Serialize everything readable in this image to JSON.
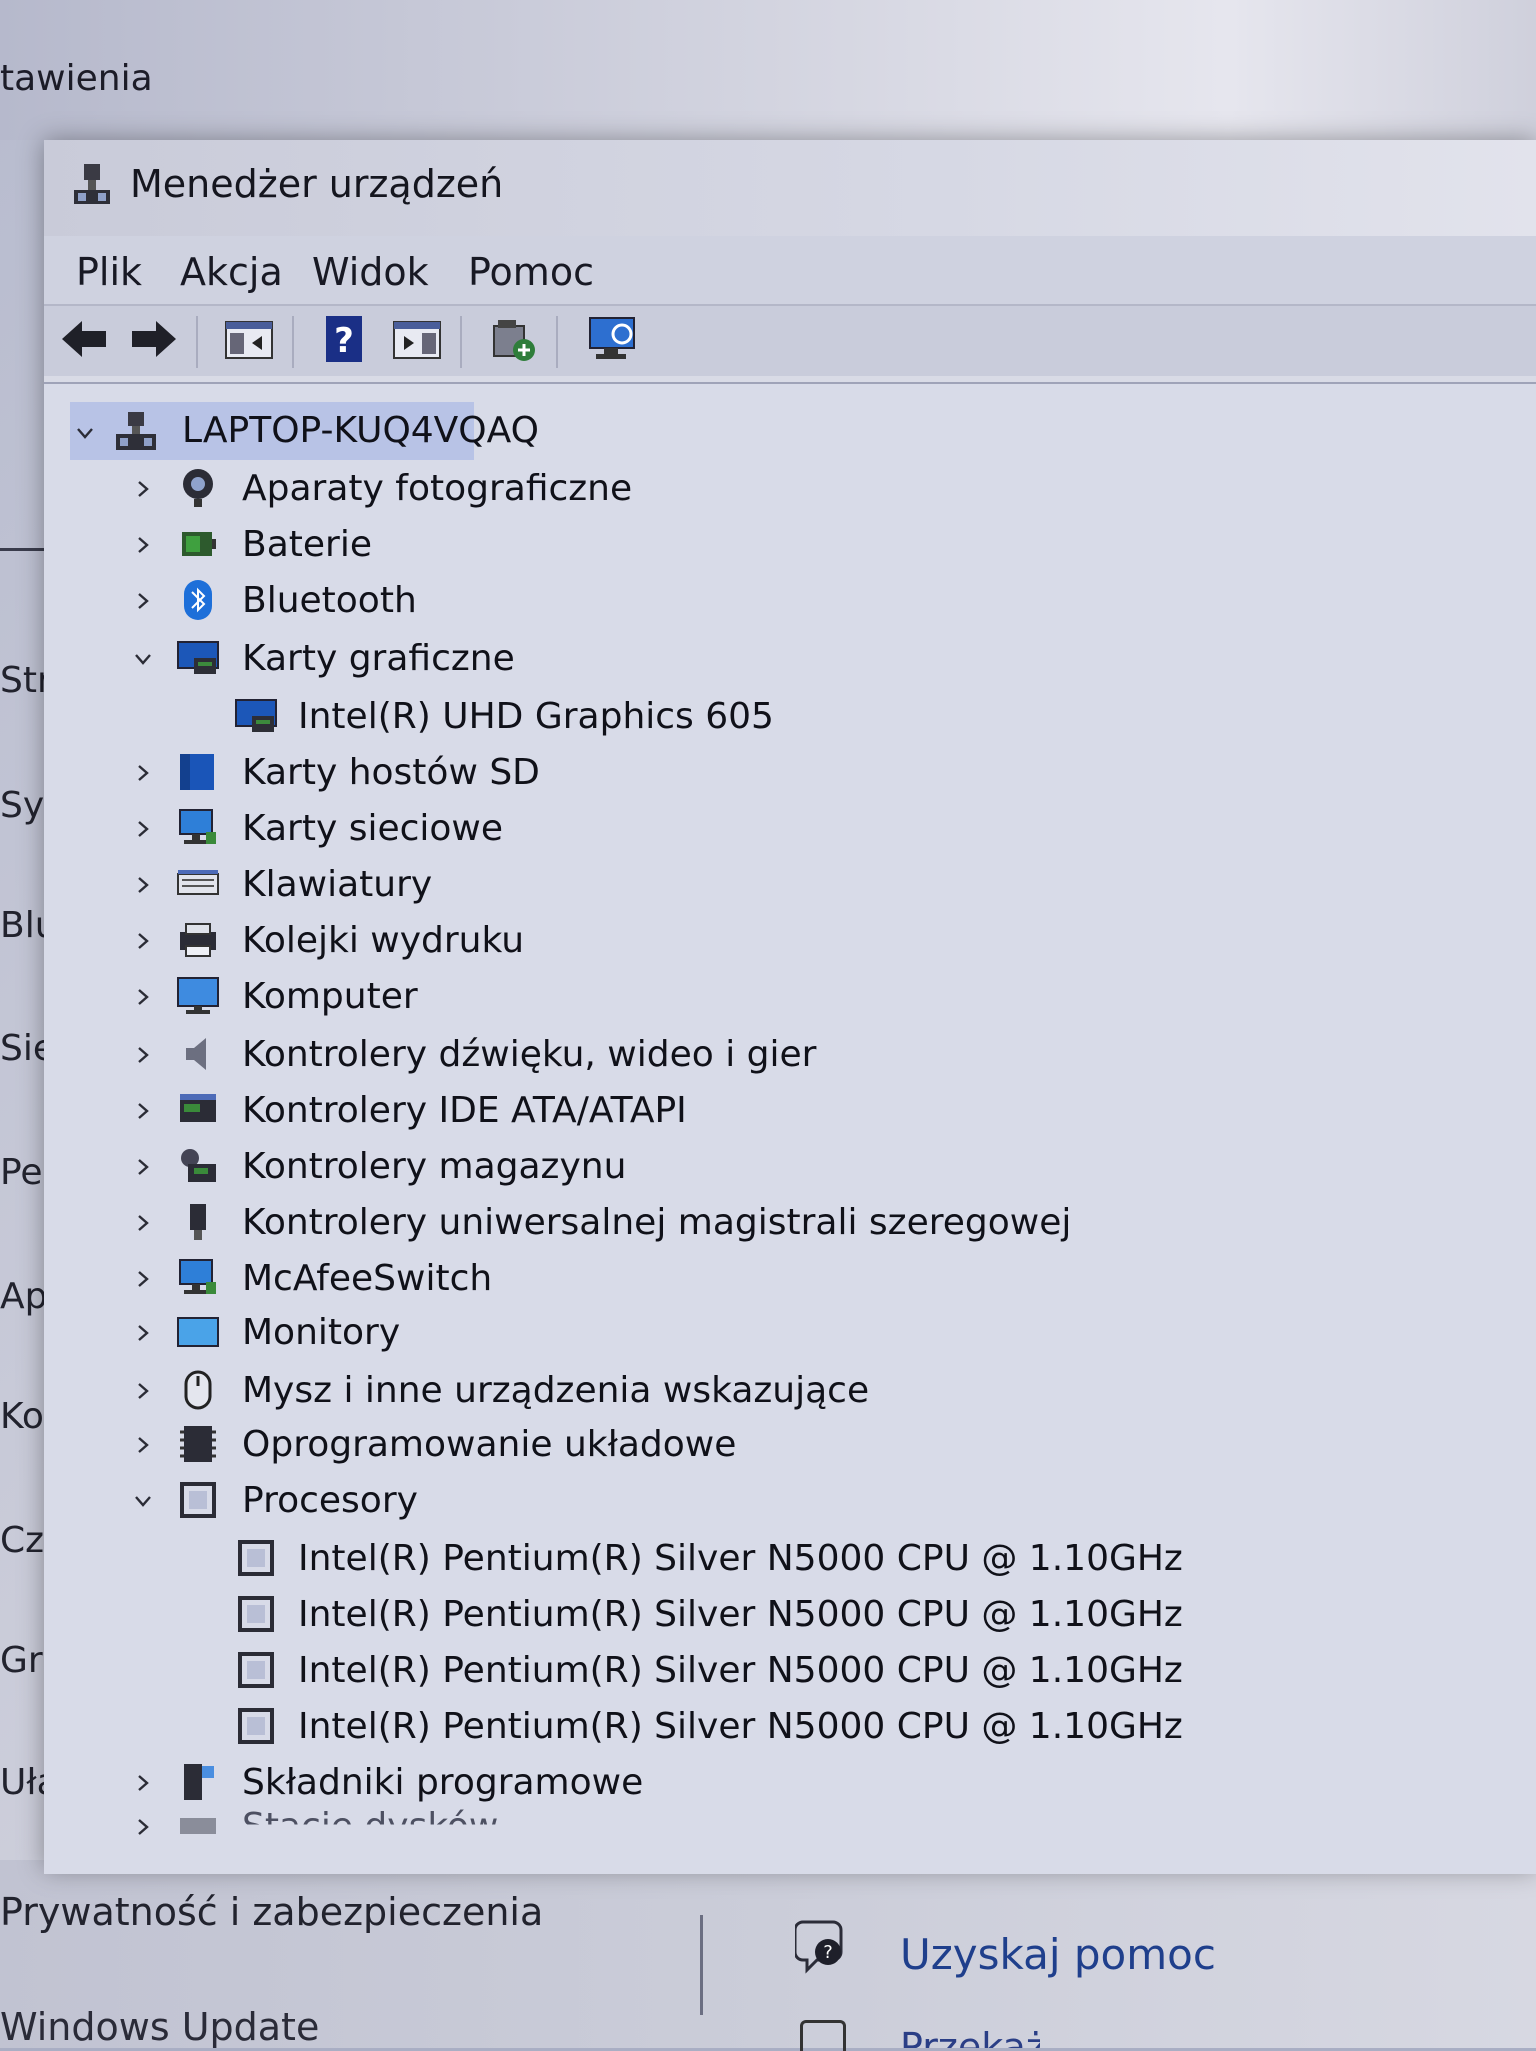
{
  "background": {
    "title": "tawienia",
    "nav_fragments": [
      "Stri",
      "Sys",
      "Blu",
      "Sie",
      "Per",
      "Ap",
      "Koi",
      "Cza",
      "Gra",
      "Uła"
    ],
    "privacy_label": "Prywatność i zabezpieczenia",
    "update_label": "Windows Update",
    "help_label": "Uzyskaj pomoc",
    "feedback_label": "Przekaż opinię"
  },
  "window": {
    "title": "Menedżer urządzeń",
    "menu": [
      "Plik",
      "Akcja",
      "Widok",
      "Pomoc"
    ],
    "toolbar_icons": [
      "back-arrow-icon",
      "forward-arrow-icon",
      "properties-panel-icon",
      "help-icon",
      "action-pane-icon",
      "update-driver-icon",
      "monitor-scan-icon"
    ]
  },
  "tree": {
    "root": "LAPTOP-KUQ4VQAQ",
    "items": [
      {
        "label": "Aparaty fotograficzne",
        "icon": "camera-icon",
        "expanded": false
      },
      {
        "label": "Baterie",
        "icon": "battery-icon",
        "expanded": false
      },
      {
        "label": "Bluetooth",
        "icon": "bluetooth-icon",
        "expanded": false
      },
      {
        "label": "Karty graficzne",
        "icon": "display-adapter-icon",
        "expanded": true
      },
      {
        "label": "Intel(R) UHD Graphics 605",
        "icon": "display-adapter-icon",
        "child": true
      },
      {
        "label": "Karty hostów SD",
        "icon": "sd-host-icon",
        "expanded": false
      },
      {
        "label": "Karty sieciowe",
        "icon": "network-adapter-icon",
        "expanded": false
      },
      {
        "label": "Klawiatury",
        "icon": "keyboard-icon",
        "expanded": false
      },
      {
        "label": "Kolejki wydruku",
        "icon": "printer-icon",
        "expanded": false
      },
      {
        "label": "Komputer",
        "icon": "computer-icon",
        "expanded": false
      },
      {
        "label": "Kontrolery dźwięku, wideo i gier",
        "icon": "speaker-icon",
        "expanded": false
      },
      {
        "label": "Kontrolery IDE ATA/ATAPI",
        "icon": "ide-controller-icon",
        "expanded": false
      },
      {
        "label": "Kontrolery magazynu",
        "icon": "storage-controller-icon",
        "expanded": false
      },
      {
        "label": "Kontrolery uniwersalnej magistrali szeregowej",
        "icon": "usb-icon",
        "expanded": false
      },
      {
        "label": "McAfeeSwitch",
        "icon": "network-adapter-icon",
        "expanded": false
      },
      {
        "label": "Monitory",
        "icon": "monitor-icon",
        "expanded": false
      },
      {
        "label": "Mysz i inne urządzenia wskazujące",
        "icon": "mouse-icon",
        "expanded": false
      },
      {
        "label": "Oprogramowanie układowe",
        "icon": "firmware-icon",
        "expanded": false
      },
      {
        "label": "Procesory",
        "icon": "processor-icon",
        "expanded": true
      },
      {
        "label": "Intel(R) Pentium(R) Silver N5000 CPU @ 1.10GHz",
        "icon": "processor-icon",
        "child": true
      },
      {
        "label": "Intel(R) Pentium(R) Silver N5000 CPU @ 1.10GHz",
        "icon": "processor-icon",
        "child": true
      },
      {
        "label": "Intel(R) Pentium(R) Silver N5000 CPU @ 1.10GHz",
        "icon": "processor-icon",
        "child": true
      },
      {
        "label": "Intel(R) Pentium(R) Silver N5000 CPU @ 1.10GHz",
        "icon": "processor-icon",
        "child": true
      },
      {
        "label": "Składniki programowe",
        "icon": "software-component-icon",
        "expanded": false
      },
      {
        "label": "Stacje dysków",
        "icon": "disk-drive-icon",
        "expanded": false
      }
    ]
  }
}
